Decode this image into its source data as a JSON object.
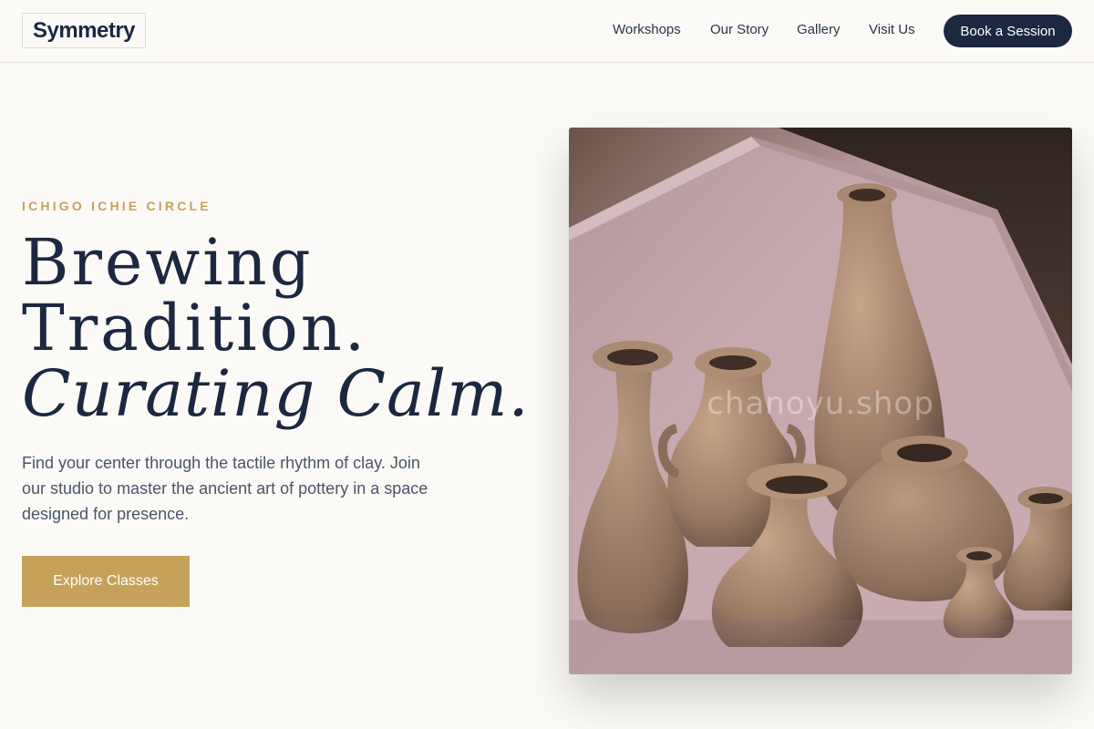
{
  "header": {
    "logo": "Symmetry",
    "nav": [
      "Workshops",
      "Our Story",
      "Gallery",
      "Visit Us"
    ],
    "cta": "Book a Session"
  },
  "hero": {
    "eyebrow": "ICHIGO ICHIE CIRCLE",
    "headline": [
      "Brewing",
      "Tradition.",
      "Curating Calm."
    ],
    "lede": "Find your center through the tactile rhythm of clay. Join our studio to master the ancient art of pottery in a space designed for presence.",
    "cta": "Explore Classes"
  },
  "image": {
    "subject": "clay pottery vases",
    "watermark": "chanoyu.shop"
  },
  "colors": {
    "background": "#fbfaf7",
    "navy": "#1c2840",
    "gold": "#c6a15a",
    "body_text": "#4a5568"
  }
}
